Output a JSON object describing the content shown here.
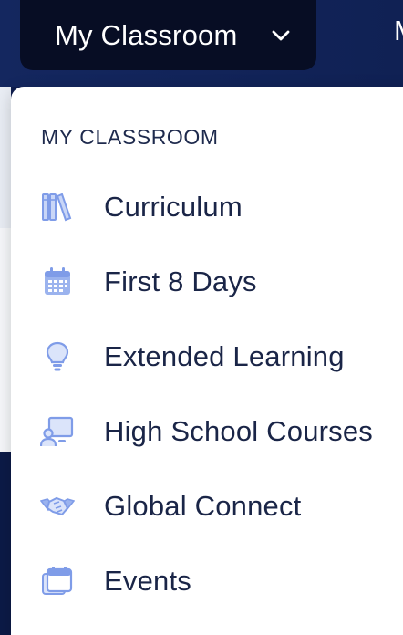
{
  "colors": {
    "nav_bg": "#14275f",
    "nav_button_bg": "#070d24",
    "icon_blue": "#7f9ce8",
    "text_dark": "#1a2547",
    "dropdown_bg": "#ffffff"
  },
  "nav": {
    "button_label": "My Classroom",
    "chevron_icon": "chevron-down-icon",
    "next_item_partial": "M"
  },
  "dropdown": {
    "heading": "MY CLASSROOM",
    "items": [
      {
        "label": "Curriculum",
        "icon": "books-icon"
      },
      {
        "label": "First 8 Days",
        "icon": "calendar-icon"
      },
      {
        "label": "Extended Learning",
        "icon": "lightbulb-icon"
      },
      {
        "label": "High School Courses",
        "icon": "presentation-icon"
      },
      {
        "label": "Global Connect",
        "icon": "handshake-icon"
      },
      {
        "label": "Events",
        "icon": "calendar-stack-icon"
      }
    ]
  }
}
